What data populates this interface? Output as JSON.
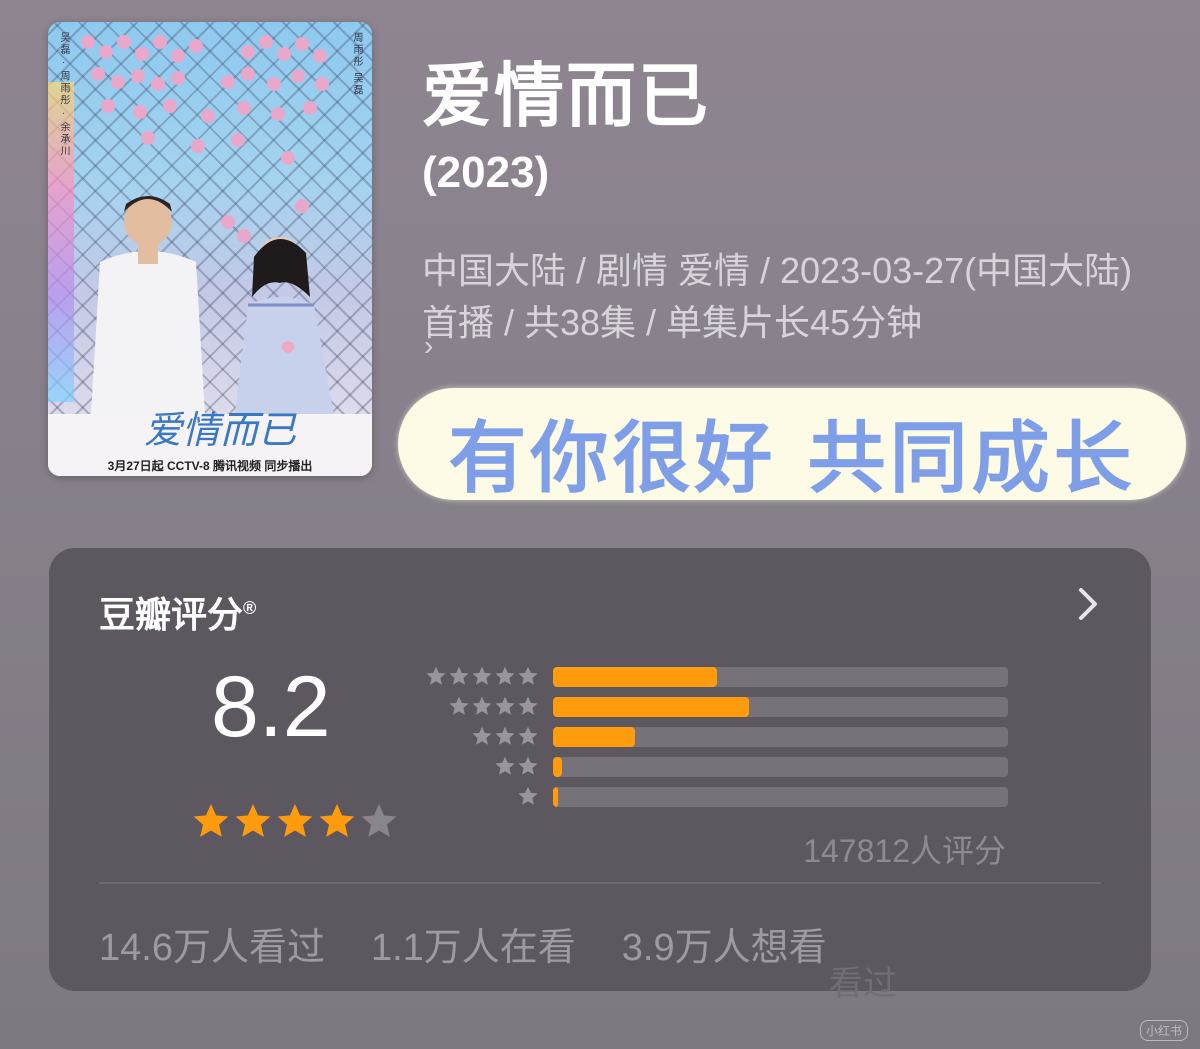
{
  "poster": {
    "side_left": "吴磊 · 周雨彤 · 余承川",
    "side_right": "周雨彤 吴磊",
    "logo": "爱情而已",
    "release": "3月27日起 CCTV-8 腾讯视频 同步播出"
  },
  "title": "爱情而已",
  "year": "(2023)",
  "meta": "中国大陆 / 剧情 爱情 / 2023-03-27(中国大陆)首播 / 共38集 / 单集片长45分钟",
  "meta_chevron": "›",
  "sticker": "有你很好 共同成长",
  "rating": {
    "title": "豆瓣评分",
    "reg": "®",
    "score": "8.2",
    "stars": 4,
    "count_label": "147812人评分",
    "distribution": [
      {
        "stars": 5,
        "fraction": 0.36
      },
      {
        "stars": 4,
        "fraction": 0.43
      },
      {
        "stars": 3,
        "fraction": 0.18
      },
      {
        "stars": 2,
        "fraction": 0.02
      },
      {
        "stars": 1,
        "fraction": 0.01
      }
    ],
    "stats": [
      "14.6万人看过",
      "1.1万人在看",
      "3.9万人想看"
    ],
    "ghost": "看过"
  },
  "colors": {
    "accent": "#ff9c0e",
    "card": "#5d575f",
    "sticker_text": "#7e9fe8"
  },
  "watermark": "小红书"
}
